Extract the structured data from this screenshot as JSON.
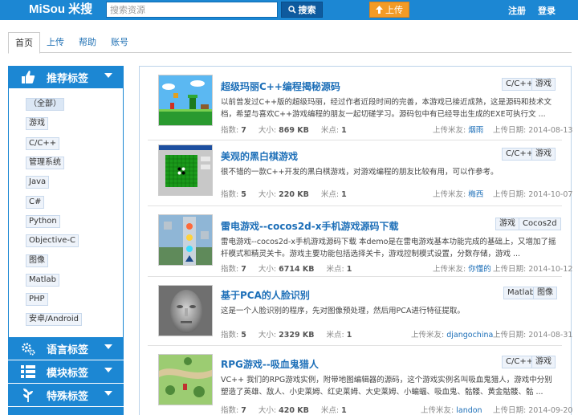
{
  "header": {
    "logo": "MiSou 米搜",
    "search_placeholder": "搜索资源",
    "search_label": "搜索",
    "upload_label": "上传",
    "register_label": "注册",
    "login_label": "登录"
  },
  "tabs": [
    "首页",
    "上传",
    "帮助",
    "账号"
  ],
  "sidebar": {
    "recommend_title": "推荐标签",
    "language_title": "语言标签",
    "module_title": "模块标签",
    "special_title": "特殊标签",
    "tags": [
      "（全部）",
      "游戏",
      "C/C++",
      "管理系统",
      "Java",
      "C#",
      "Python",
      "Objective-C",
      "图像",
      "Matlab",
      "PHP",
      "安卓/Android"
    ]
  },
  "meta_labels": {
    "index": "指数:",
    "size": "大小:",
    "points": "米点:",
    "uploader": "上传米友:",
    "date": "上传日期:"
  },
  "items": [
    {
      "title": "超级玛丽C++编程揭秘源码",
      "tags": [
        "C/C++",
        "游戏"
      ],
      "desc": "以前曾发过C++版的超级玛丽，经过作者近段时间的完善，本游戏已接近成熟，这是源码和技术文档，希望与喜欢C++游戏编程的朋友一起切磋学习。源码包中有已经导出生成的EXE可执行文 ...",
      "index": "7",
      "size": "869 KB",
      "points": "1",
      "uploader": "烟雨",
      "date": "2014-08-13"
    },
    {
      "title": "美观的黑白棋游戏",
      "tags": [
        "C/C++",
        "游戏"
      ],
      "desc": "很不错的一款C++开发的黑白棋游戏，对游戏编程的朋友比较有用，可以作参考。",
      "index": "5",
      "size": "220 KB",
      "points": "1",
      "uploader": "梅西",
      "date": "2014-10-07"
    },
    {
      "title": "雷电游戏--cocos2d-x手机游戏源码下载",
      "tags": [
        "游戏",
        "Cocos2d"
      ],
      "desc": "雷电游戏--cocos2d-x手机游戏源码下载 本demo是在雷电游戏基本功能完成的基础上，又增加了摇杆模式和精灵关卡。游戏主要功能包括选择关卡，游戏控制模式设置，分数存储，游戏 ...",
      "index": "7",
      "size": "6714 KB",
      "points": "1",
      "uploader": "你懂的",
      "date": "2014-10-12"
    },
    {
      "title": "基于PCA的人脸识别",
      "tags": [
        "Matlab",
        "图像"
      ],
      "desc": "这是一个人脸识别的程序，先对图像预处理，然后用PCA进行特征提取。",
      "index": "5",
      "size": "2329 KB",
      "points": "1",
      "uploader": "djangochina",
      "date": "2014-08-31"
    },
    {
      "title": "RPG游戏--吸血鬼猎人",
      "tags": [
        "C/C++",
        "游戏"
      ],
      "desc": "VC++ 我们的RPG游戏实例，附带地图编辑器的源码，这个游戏实例名叫吸血鬼猎人，游戏中分别塑造了英雄、敌人、小史莱姆、红史莱姆、大史莱姆、小蝙蝠、吸血鬼、骷髅、黄金骷髅、骷 ...",
      "index": "7",
      "size": "420 KB",
      "points": "1",
      "uploader": "landon",
      "date": "2014-09-20"
    }
  ],
  "colors": {
    "primary": "#1c87d3",
    "accent": "#f39b26",
    "link": "#1d6fb8"
  }
}
